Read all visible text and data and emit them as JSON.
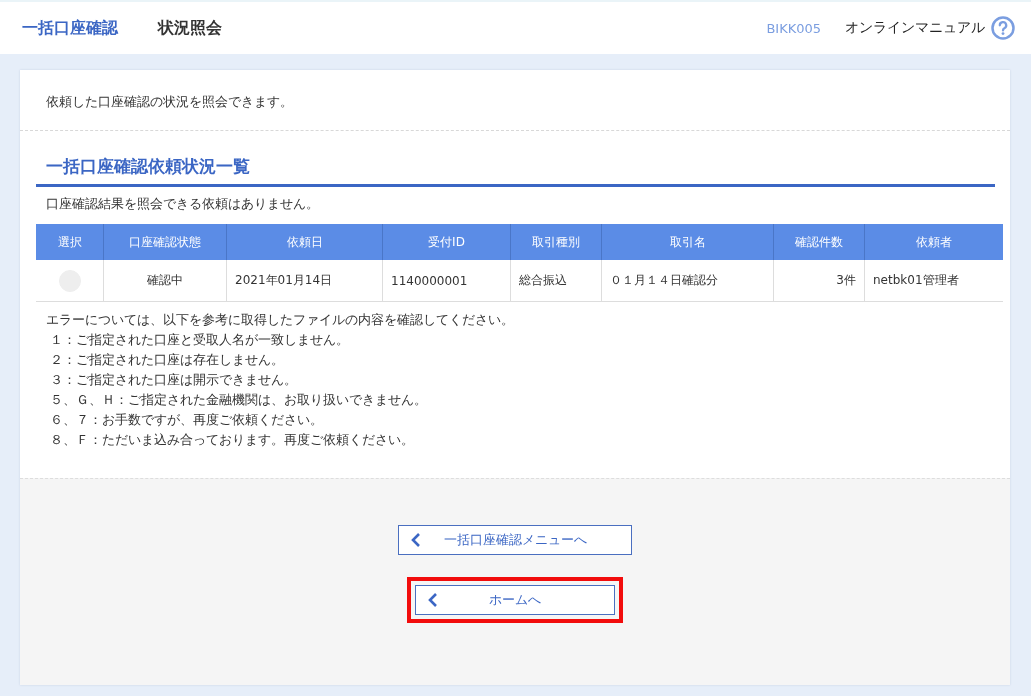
{
  "header": {
    "title": "一括口座確認",
    "subtitle": "状況照会",
    "screen_id": "BIKK005",
    "manual_link": "オンラインマニュアル"
  },
  "intro": "依頼した口座確認の状況を照会できます。",
  "section": {
    "title": "一括口座確認依頼状況一覧",
    "message": "口座確認結果を照会できる依頼はありません。"
  },
  "table": {
    "columns": [
      "選択",
      "口座確認状態",
      "依頼日",
      "受付ID",
      "取引種別",
      "取引名",
      "確認件数",
      "依頼者"
    ],
    "rows": [
      {
        "selected": false,
        "disabled": true,
        "cells": [
          "",
          "確認中",
          "2021年01月14日",
          "1140000001",
          "総合振込",
          "０１月１４日確認分",
          "3件",
          "netbk01管理者"
        ]
      }
    ]
  },
  "notes": [
    "エラーについては、以下を参考に取得したファイルの内容を確認してください。",
    "１：ご指定された口座と受取人名が一致しません。",
    "２：ご指定された口座は存在しません。",
    "３：ご指定された口座は開示できません。",
    "５、Ｇ、Ｈ：ご指定された金融機関は、お取り扱いできません。",
    "６、７：お手数ですが、再度ご依頼ください。",
    "８、Ｆ：ただいま込み合っております。再度ご依頼ください。"
  ],
  "buttons": [
    {
      "label": "一括口座確認メニューへ",
      "highlighted": false
    },
    {
      "label": "ホームへ",
      "highlighted": true
    }
  ]
}
